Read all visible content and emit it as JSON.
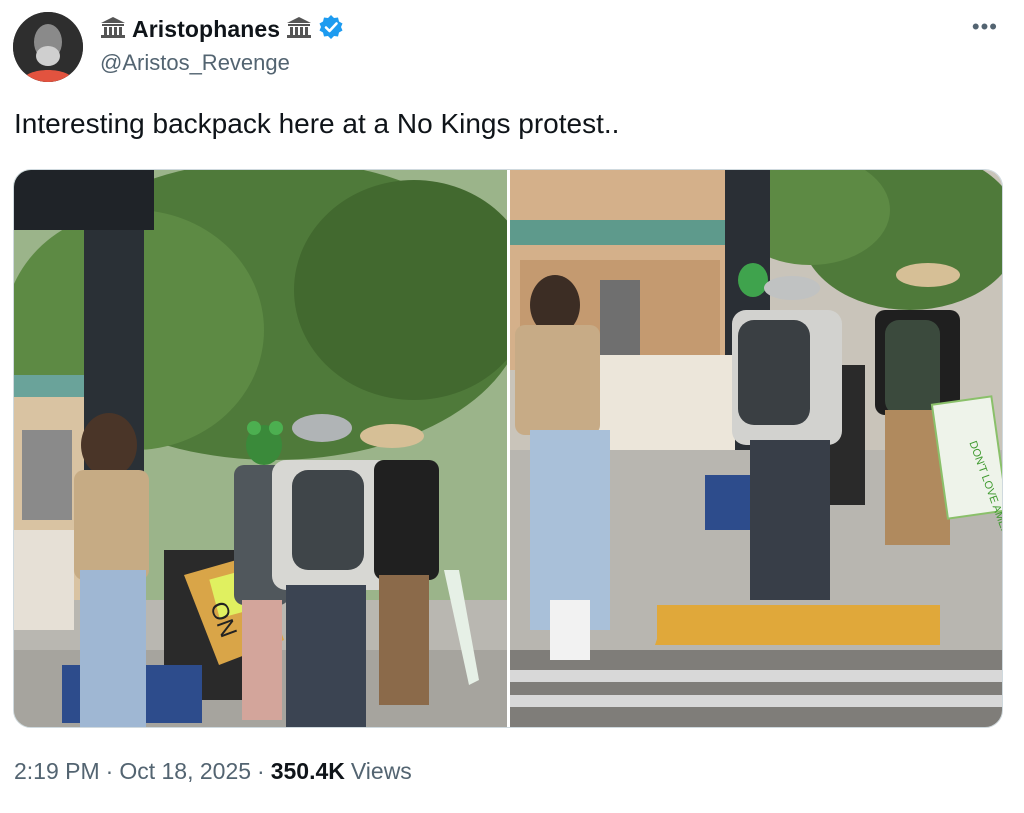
{
  "author": {
    "display_name": "Aristophanes",
    "handle": "@Aristos_Revenge",
    "emoji_icon": "classical-building-icon",
    "verified_icon": "verified-badge-icon",
    "verified_color": "#1d9bf0"
  },
  "menu": {
    "more_label": "•••"
  },
  "tweet": {
    "text": "Interesting backpack here at a No Kings protest.."
  },
  "media": {
    "left_photo": {
      "sign_text": "ON"
    },
    "right_photo": {
      "sign_text": "DON'T LOVE AMERICA"
    }
  },
  "meta": {
    "time": "2:19 PM",
    "separator": "·",
    "date": "Oct 18, 2025",
    "views_count": "350.4K",
    "views_label": "Views"
  }
}
